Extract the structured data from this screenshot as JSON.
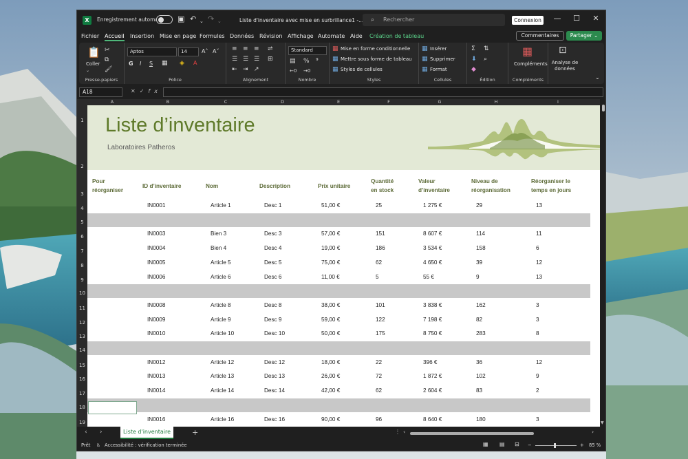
{
  "titlebar": {
    "autosave_label": "Enregistrement automatique",
    "doc_title": "Liste d'inventaire avec mise en surbrillance1 -...",
    "search_placeholder": "Rechercher",
    "signin_label": "Connexion"
  },
  "menu": {
    "items": [
      "Fichier",
      "Accueil",
      "Insertion",
      "Mise en page",
      "Formules",
      "Données",
      "Révision",
      "Affichage",
      "Automate",
      "Aide"
    ],
    "active_index": 1,
    "contextual": "Création de tableau",
    "comments_label": "Commentaires",
    "share_label": "Partager"
  },
  "ribbon": {
    "paste_label": "Coller",
    "clipboard_label": "Presse-papiers",
    "font_name": "Aptos",
    "font_size": "14",
    "font_group_label": "Police",
    "alignment_label": "Alignement",
    "number_format": "Standard",
    "number_label": "Nombre",
    "conditional_label": "Mise en forme conditionnelle",
    "format_as_table_label": "Mettre sous forme de tableau",
    "cell_styles_label": "Styles de cellules",
    "styles_label": "Styles",
    "insert_label": "Insérer",
    "delete_label": "Supprimer",
    "format_label": "Format",
    "cells_label": "Cellules",
    "edit_label": "Édition",
    "addins_label": "Compléments",
    "addins_group_label": "Compléments",
    "analyze_label": "Analyse de données"
  },
  "formula_bar": {
    "name_box": "A18",
    "fx_label": "fx",
    "value": ""
  },
  "columns": [
    "A",
    "B",
    "C",
    "D",
    "E",
    "F",
    "G",
    "H",
    "I"
  ],
  "rows": [
    "1",
    "2",
    "3",
    "4",
    "5",
    "6",
    "7",
    "8",
    "9",
    "10",
    "11",
    "12",
    "13",
    "14",
    "15",
    "16",
    "17",
    "18",
    "19"
  ],
  "sheet": {
    "title": "Liste d’inventaire",
    "subtitle": "Laboratoires Patheros",
    "headers": [
      {
        "line1": "Pour",
        "line2": "réorganiser"
      },
      {
        "line1": "ID d’inventaire",
        "line2": ""
      },
      {
        "line1": "Nom",
        "line2": ""
      },
      {
        "line1": "Description",
        "line2": ""
      },
      {
        "line1": "Prix unitaire",
        "line2": ""
      },
      {
        "line1": "Quantité",
        "line2": "en stock"
      },
      {
        "line1": "Valeur",
        "line2": "d’inventaire"
      },
      {
        "line1": "Niveau de",
        "line2": "réorganisation"
      },
      {
        "line1": "Réorganiser le",
        "line2": "temps en jours"
      }
    ],
    "data_rows": [
      {
        "id": "IN0001",
        "name": "Article 1",
        "desc": "Desc 1",
        "price": "51,00 €",
        "qty": "25",
        "value": "1 275 €",
        "reorder": "29",
        "days": "13"
      },
      {
        "id": "IN0003",
        "name": "Bien 3",
        "desc": "Desc 3",
        "price": "57,00 €",
        "qty": "151",
        "value": "8 607 €",
        "reorder": "114",
        "days": "11"
      },
      {
        "id": "IN0004",
        "name": "Bien 4",
        "desc": "Desc 4",
        "price": "19,00 €",
        "qty": "186",
        "value": "3 534 €",
        "reorder": "158",
        "days": "6"
      },
      {
        "id": "IN0005",
        "name": "Article 5",
        "desc": "Desc 5",
        "price": "75,00 €",
        "qty": "62",
        "value": "4 650 €",
        "reorder": "39",
        "days": "12"
      },
      {
        "id": "IN0006",
        "name": "Article 6",
        "desc": "Desc 6",
        "price": "11,00 €",
        "qty": "5",
        "value": "55 €",
        "reorder": "9",
        "days": "13"
      },
      {
        "id": "IN0008",
        "name": "Article 8",
        "desc": "Desc 8",
        "price": "38,00 €",
        "qty": "101",
        "value": "3 838 €",
        "reorder": "162",
        "days": "3"
      },
      {
        "id": "IN0009",
        "name": "Article 9",
        "desc": "Desc 9",
        "price": "59,00 €",
        "qty": "122",
        "value": "7 198 €",
        "reorder": "82",
        "days": "3"
      },
      {
        "id": "IN0010",
        "name": "Article 10",
        "desc": "Desc 10",
        "price": "50,00 €",
        "qty": "175",
        "value": "8 750 €",
        "reorder": "283",
        "days": "8"
      },
      {
        "id": "IN0012",
        "name": "Article 12",
        "desc": "Desc 12",
        "price": "18,00 €",
        "qty": "22",
        "value": "396 €",
        "reorder": "36",
        "days": "12"
      },
      {
        "id": "IN0013",
        "name": "Article 13",
        "desc": "Desc 13",
        "price": "26,00 €",
        "qty": "72",
        "value": "1 872 €",
        "reorder": "102",
        "days": "9"
      },
      {
        "id": "IN0014",
        "name": "Article 14",
        "desc": "Desc 14",
        "price": "42,00 €",
        "qty": "62",
        "value": "2 604 €",
        "reorder": "83",
        "days": "2"
      },
      {
        "id": "IN0016",
        "name": "Article 16",
        "desc": "Desc 16",
        "price": "90,00 €",
        "qty": "96",
        "value": "8 640 €",
        "reorder": "180",
        "days": "3"
      }
    ]
  },
  "tabs": {
    "active_sheet": "Liste d'inventaire"
  },
  "status": {
    "ready": "Prêt",
    "accessibility": "Accessibilité : vérification terminée",
    "zoom": "85 %"
  },
  "colors": {
    "accent_green": "#5f7a2a",
    "banner_bg": "#e3e9d6",
    "highlight_row": "#c8c8c8",
    "excel_green": "#107c41"
  }
}
